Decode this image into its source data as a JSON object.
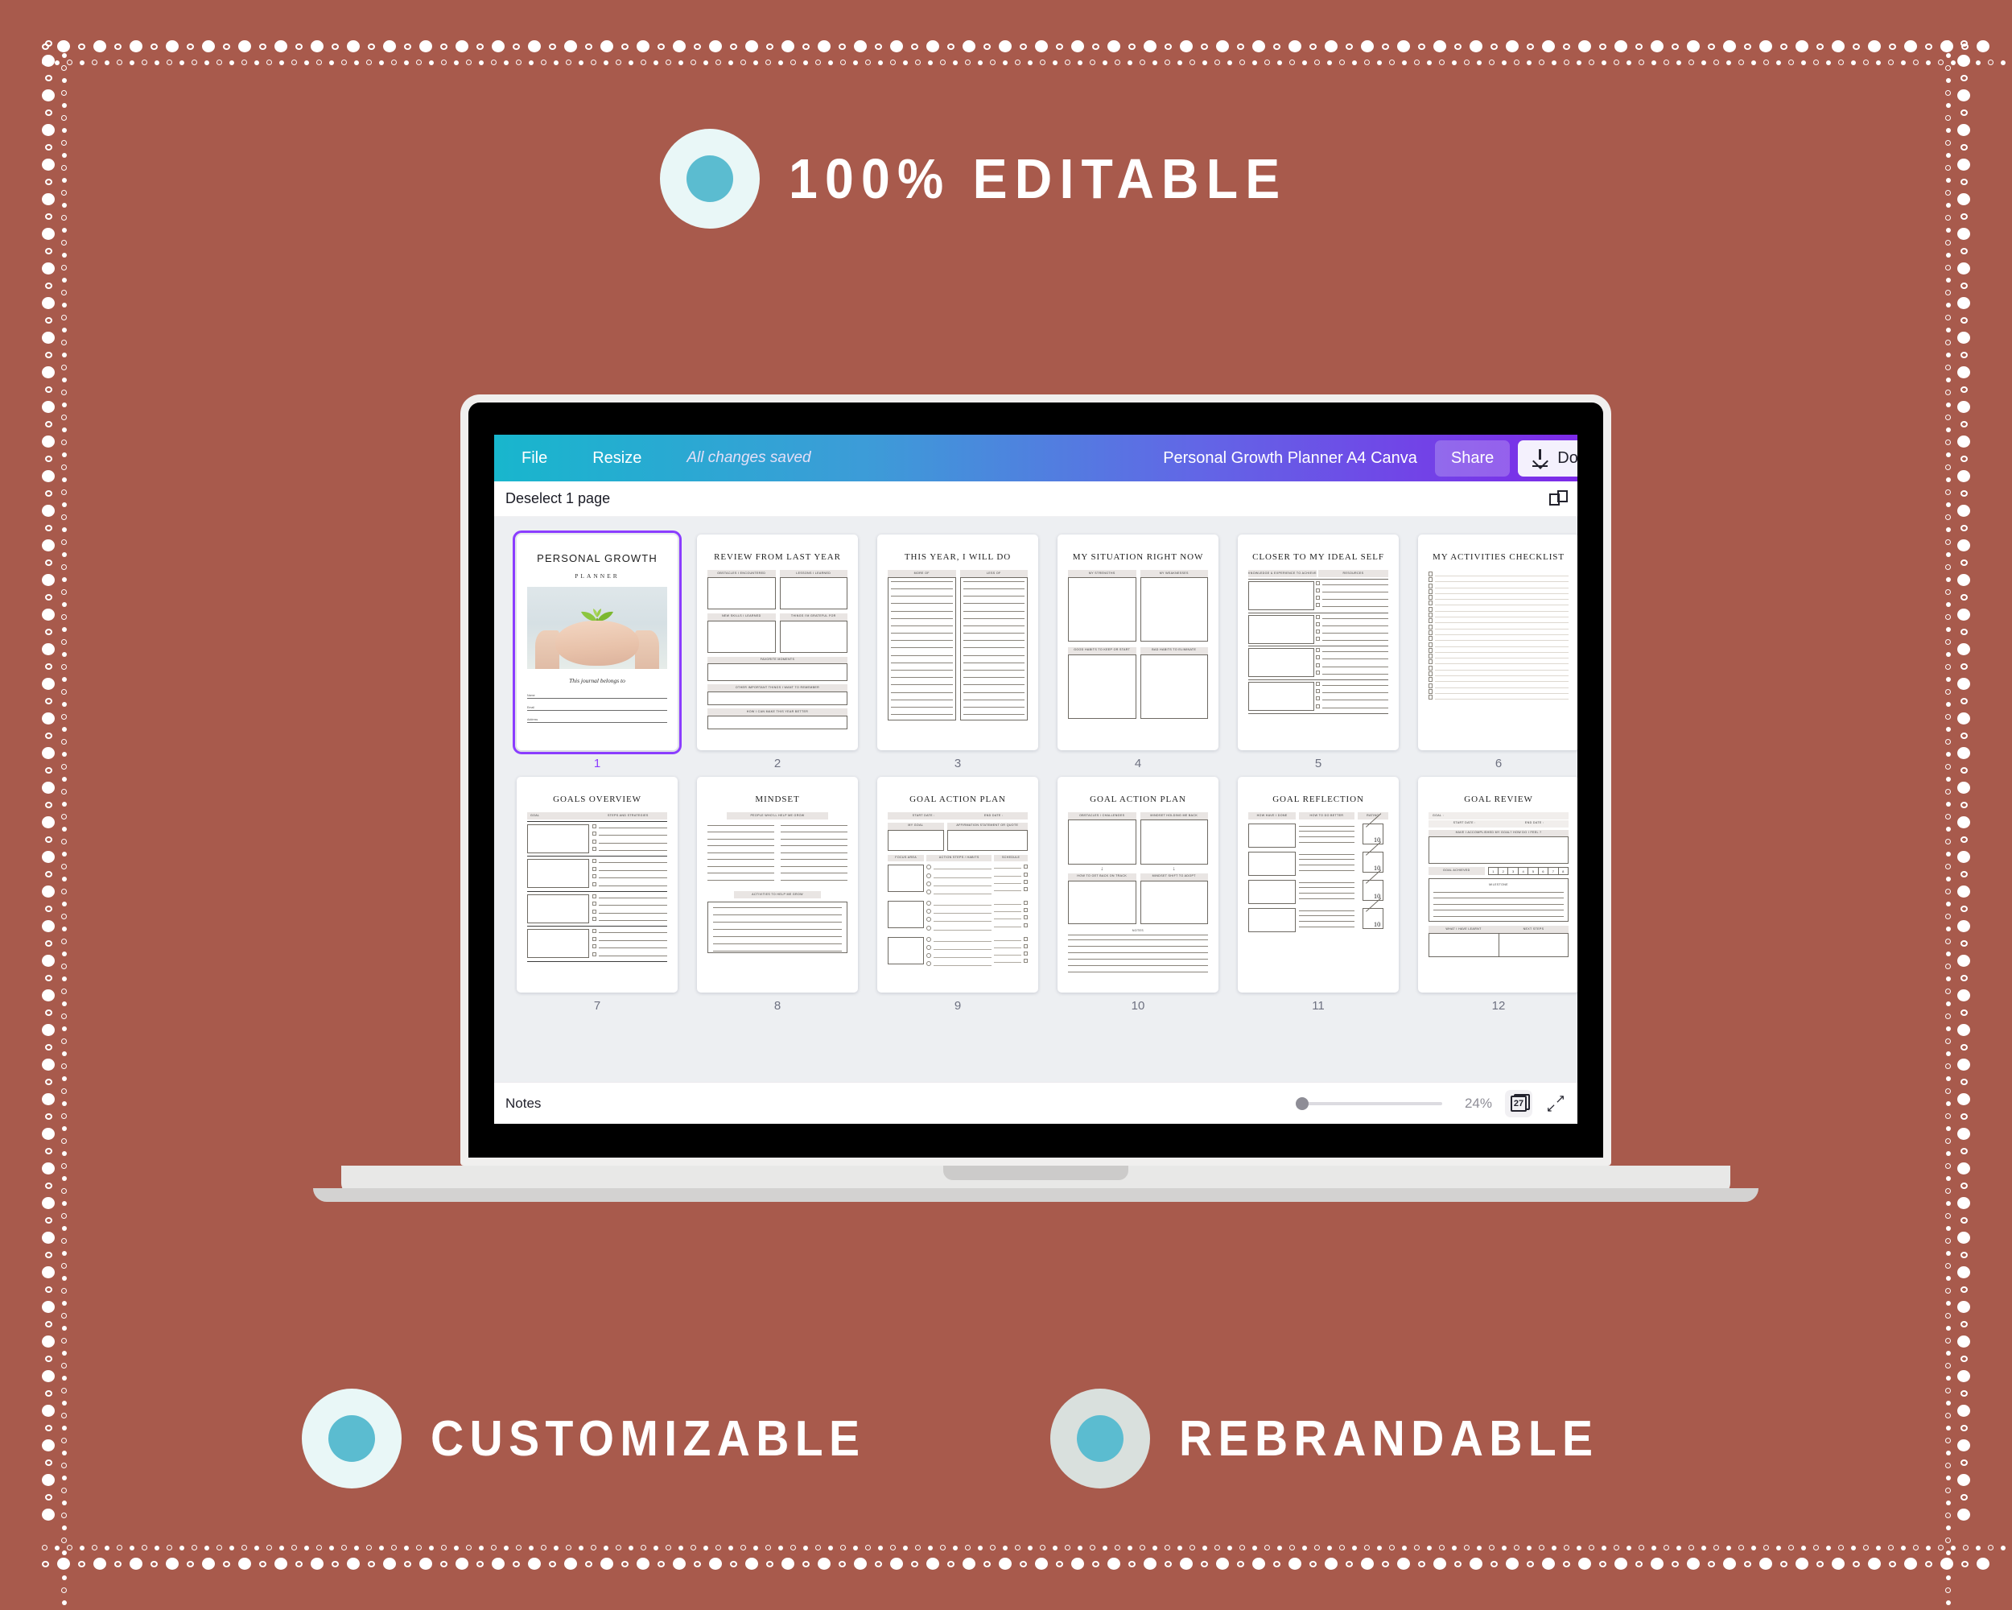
{
  "background_color": "#a85a4c",
  "taglines": [
    {
      "id": "top",
      "text": "100% EDITABLE",
      "badge_color": "#e9f7f7",
      "dot_color": "#5bbcd0"
    },
    {
      "id": "customizable",
      "text": "CUSTOMIZABLE",
      "badge_color": "#e9f7f7",
      "dot_color": "#5bbcd0"
    },
    {
      "id": "rebrandable",
      "text": "REBRANDABLE",
      "badge_color": "#d9e0dd",
      "dot_color": "#5bbcd0"
    }
  ],
  "app": {
    "topbar": {
      "file_label": "File",
      "resize_label": "Resize",
      "saved_label": "All changes saved",
      "doc_title": "Personal Growth Planner A4 Canva",
      "share_label": "Share",
      "download_label": "Downlo",
      "accent_start": "#18b6cd",
      "accent_end": "#7d2ae8"
    },
    "subbar": {
      "deselect_label": "Deselect 1 page",
      "grid_icon": "add-page-icon"
    },
    "bottombar": {
      "notes_label": "Notes",
      "zoom_percent": "24%",
      "page_count": "27",
      "expand_icon": "expand-icon",
      "slider_value": 0
    }
  },
  "pages": [
    {
      "number": "1",
      "selected": true,
      "type": "cover",
      "title": "PERSONAL GROWTH",
      "subtitle": "PLANNER",
      "belongs": "This journal belongs to",
      "fields": [
        "Name",
        "Email",
        "Address"
      ]
    },
    {
      "number": "2",
      "selected": false,
      "type": "review-last-year",
      "title": "REVIEW FROM LAST YEAR",
      "boxes_2col": [
        "OBSTACLES I ENCOUNTERED",
        "LESSONS I LEARNED",
        "NEW SKILLS I LEARNED",
        "THINGS I'M GRATEFUL FOR"
      ],
      "boxes_full": [
        "FAVORITE MOMENTS",
        "OTHER IMPORTANT THINGS I WANT TO REMEMBER",
        "HOW I CAN MAKE THIS YEAR BETTER"
      ]
    },
    {
      "number": "3",
      "selected": false,
      "type": "two-lists",
      "title": "THIS  YEAR,  I WILL  DO",
      "columns": [
        "MORE  OF",
        "LESS  OF"
      ],
      "lines_per_column": 19
    },
    {
      "number": "4",
      "selected": false,
      "type": "four-quadrants",
      "title": "MY SITUATION RIGHT NOW",
      "quadrants": [
        "MY  STRENGTHS",
        "MY  WEAKNESSES",
        "GOOD  HABITS  TO  KEEP  OR  START",
        "BAD  HABITS  TO  ELIMINATE"
      ]
    },
    {
      "number": "5",
      "selected": false,
      "type": "knowledge-resources",
      "title": "CLOSER TO MY IDEAL SELF",
      "columns": [
        "KNOWLEDGE  &  EXPERIENCE  TO  ACHIEVE",
        "RESOURCES"
      ],
      "rows": 4,
      "checks_per_row": 4
    },
    {
      "number": "6",
      "selected": false,
      "type": "checklist",
      "title": "MY ACTIVITIES CHECKLIST",
      "rows": 22
    },
    {
      "number": "7",
      "selected": false,
      "type": "goals-overview",
      "title": "GOALS OVERVIEW",
      "columns": [
        "GOAL",
        "STEPS  AND  STRATEGIES"
      ],
      "rows": 4,
      "checks_per_row": 4
    },
    {
      "number": "8",
      "selected": false,
      "type": "mindset",
      "title": "MINDSET",
      "headers": [
        "PEOPLE WHO'LL  HELP ME  GROW",
        "ACTIVITIES  TO  HELP  ME  GROW"
      ],
      "lines_per_column": 9,
      "activity_lines": 7
    },
    {
      "number": "9",
      "selected": false,
      "type": "goal-action-plan-a",
      "title": "GOAL ACTION PLAN",
      "date_row": [
        "START  DATE :",
        "END  DATE :"
      ],
      "headers": [
        "MY GOAL",
        "AFFIRMATION STATEMENT OR QUOTE"
      ],
      "table_headers": [
        "FOCUS  AREA",
        "ACTION  STEPS  /  HABITS",
        "SCHEDULE"
      ],
      "groups": 3,
      "steps_per_group": 4
    },
    {
      "number": "10",
      "selected": false,
      "type": "goal-action-plan-b",
      "title": "GOAL ACTION PLAN",
      "top_boxes": [
        "OBSTACLES / CHALLENGES",
        "MINDSET HOLDING ME BACK"
      ],
      "bottom_boxes": [
        "HOW  TO  GET  BACK  ON  TRACK",
        "MINDSET  SHIFT  TO  ADOPT"
      ],
      "notes_label": "NOTES",
      "notes_lines": 6
    },
    {
      "number": "11",
      "selected": false,
      "type": "goal-reflection",
      "title": "GOAL REFLECTION",
      "columns": [
        "HOW  HAVE  I  DONE",
        "HOW  TO  DO  BETTER",
        "RATING"
      ],
      "rows": 4,
      "rating_denominator": "10"
    },
    {
      "number": "12",
      "selected": false,
      "type": "goal-review",
      "title": "GOAL REVIEW",
      "goal_label": "GOAL :",
      "date_row": [
        "START  DATE :",
        "END  DATE :"
      ],
      "accomplished_header": "HAVE I ACCOMPLISHED MY GOAL? HOW DO I FEEL ?",
      "achieved_label": "GOAL  ACHIEVED",
      "scale": [
        "1",
        "2",
        "3",
        "4",
        "5",
        "6",
        "7",
        "8"
      ],
      "milestone_label": "MILESTONE",
      "milestone_lines": 5,
      "bottom_headers": [
        "WHAT  I  HAVE  LEARNT",
        "NEXT  STEPS"
      ]
    }
  ]
}
